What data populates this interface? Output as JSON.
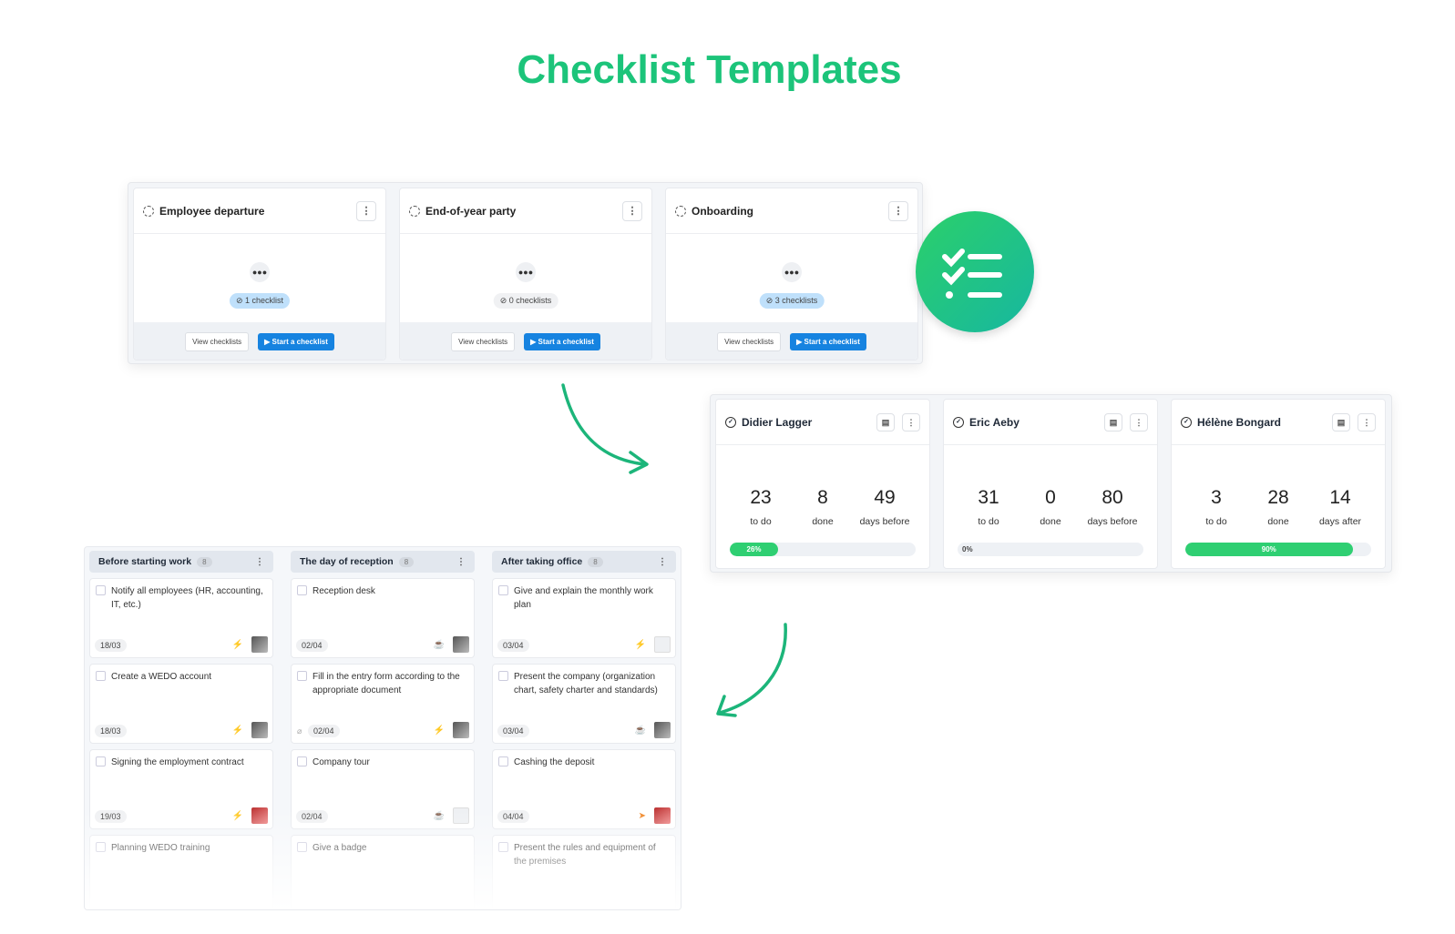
{
  "title": "Checklist Templates",
  "templates": [
    {
      "name": "Employee departure",
      "count": "1 checklist",
      "highlight": true,
      "view": "View checklists",
      "start": "Start a checklist"
    },
    {
      "name": "End-of-year party",
      "count": "0 checklists",
      "highlight": false,
      "view": "View checklists",
      "start": "Start a checklist"
    },
    {
      "name": "Onboarding",
      "count": "3 checklists",
      "highlight": true,
      "view": "View checklists",
      "start": "Start a checklist"
    }
  ],
  "people": [
    {
      "name": "Didier Lagger",
      "todo": "23",
      "todo_label": "to do",
      "done": "8",
      "done_label": "done",
      "days": "49",
      "days_label": "days before",
      "progress": 26,
      "progress_label": "26%"
    },
    {
      "name": "Eric Aeby",
      "todo": "31",
      "todo_label": "to do",
      "done": "0",
      "done_label": "done",
      "days": "80",
      "days_label": "days before",
      "progress": 0,
      "progress_label": "0%"
    },
    {
      "name": "Hélène Bongard",
      "todo": "3",
      "todo_label": "to do",
      "done": "28",
      "done_label": "done",
      "days": "14",
      "days_label": "days after",
      "progress": 90,
      "progress_label": "90%"
    }
  ],
  "board": {
    "columns": [
      {
        "title": "Before starting work",
        "count": "8",
        "cards": [
          {
            "text": "Notify all employees (HR, accounting, IT, etc.)",
            "date": "18/03",
            "prio": "orange",
            "avatar": "photo"
          },
          {
            "text": "Create a WEDO account",
            "date": "18/03",
            "prio": "orange",
            "avatar": "photo"
          },
          {
            "text": "Signing the employment contract",
            "date": "19/03",
            "prio": "orange",
            "avatar": "red"
          },
          {
            "text": "Planning WEDO training",
            "date": "",
            "prio": "",
            "avatar": ""
          }
        ]
      },
      {
        "title": "The day of reception",
        "count": "8",
        "cards": [
          {
            "text": "Reception desk",
            "date": "02/04",
            "prio": "green",
            "avatar": "photo"
          },
          {
            "text": "Fill in the entry form according to the appropriate document",
            "date": "02/04",
            "prio": "orange",
            "avatar": "photo",
            "attachment": true
          },
          {
            "text": "Company tour",
            "date": "02/04",
            "prio": "green",
            "avatar": "empty"
          },
          {
            "text": "Give a badge",
            "date": "",
            "prio": "",
            "avatar": ""
          }
        ]
      },
      {
        "title": "After taking office",
        "count": "8",
        "cards": [
          {
            "text": "Give and explain the monthly work plan",
            "date": "03/04",
            "prio": "orange",
            "avatar": "empty"
          },
          {
            "text": "Present the company (organization chart, safety charter and standards)",
            "date": "03/04",
            "prio": "green",
            "avatar": "photo"
          },
          {
            "text": "Cashing the deposit",
            "date": "04/04",
            "prio": "send",
            "avatar": "red"
          },
          {
            "text": "Present the rules and equipment of the premises",
            "date": "",
            "prio": "",
            "avatar": ""
          }
        ]
      }
    ]
  },
  "colors": {
    "accent": "#1cc47a",
    "primary": "#1683e0",
    "progress": "#2fcf72"
  }
}
